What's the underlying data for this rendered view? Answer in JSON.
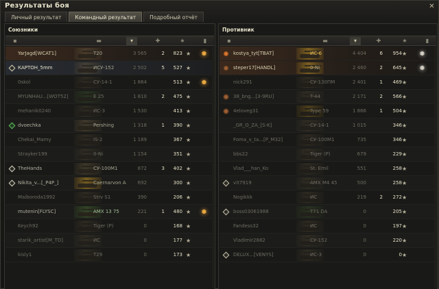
{
  "window": {
    "title": "Результаты боя",
    "close_glyph": "✕"
  },
  "tabs": [
    {
      "label": "Личный результат",
      "active": false
    },
    {
      "label": "Командный результат",
      "active": true
    },
    {
      "label": "Подробный отчёт",
      "active": false
    }
  ],
  "columns": {
    "icons": [
      "rank-icon",
      "vehicle-icon",
      "damage-icon",
      "frags-icon",
      "xp-icon",
      "medal-icon"
    ],
    "sorted_column": "damage-icon"
  },
  "allies": {
    "title": "Союзники",
    "rows": [
      {
        "name": "YarJagd[WCAT1]",
        "vehicle": "T20",
        "damage": "3 565",
        "frags": "2",
        "xp": "823",
        "badge": null,
        "medal": "gold",
        "style": "player",
        "vclass": "",
        "tank": "t-heavy",
        "dead": false
      },
      {
        "name": "КАРТОН_5mm",
        "vehicle": "ИСУ-152",
        "damage": "2 502",
        "frags": "5",
        "xp": "527",
        "badge": "diamond",
        "medal": null,
        "style": "selected",
        "vclass": "",
        "tank": "t-heavy",
        "dead": false
      },
      {
        "name": "0skol",
        "vehicle": "СУ-14-1",
        "damage": "1 864",
        "frags": "",
        "xp": "513",
        "badge": null,
        "medal": "gold",
        "style": "",
        "vclass": "",
        "tank": "t-heavy",
        "dead": true
      },
      {
        "name": "MYUNHAU...[WOT52]",
        "vehicle": "E 25",
        "damage": "1 810",
        "frags": "2",
        "xp": "475",
        "badge": null,
        "medal": null,
        "style": "",
        "vclass": "elite",
        "tank": "t-green",
        "dead": true
      },
      {
        "name": "mehanik0240",
        "vehicle": "ИС-3",
        "damage": "1 530",
        "frags": "",
        "xp": "413",
        "badge": null,
        "medal": null,
        "style": "",
        "vclass": "",
        "tank": "t-heavy",
        "dead": true
      },
      {
        "name": "dvoechka",
        "vehicle": "Pershing",
        "damage": "1 318",
        "frags": "1",
        "xp": "390",
        "badge": "green",
        "medal": null,
        "style": "",
        "vclass": "",
        "tank": "t-heavy",
        "dead": false
      },
      {
        "name": "Chekai_Mamy",
        "vehicle": "IS-2",
        "damage": "1 189",
        "frags": "",
        "xp": "367",
        "badge": null,
        "medal": null,
        "style": "",
        "vclass": "",
        "tank": "t-heavy",
        "dead": true
      },
      {
        "name": "Strayker199",
        "vehicle": "0-Ni",
        "damage": "1 154",
        "frags": "",
        "xp": "351",
        "badge": null,
        "medal": null,
        "style": "",
        "vclass": "",
        "tank": "t-heavy",
        "dead": true
      },
      {
        "name": "TheHands",
        "vehicle": "СУ-100М1",
        "damage": "872",
        "frags": "3",
        "xp": "402",
        "badge": "diamond",
        "medal": null,
        "style": "",
        "vclass": "",
        "tank": "t-heavy",
        "dead": false
      },
      {
        "name": "Nikita_v...[_P4P_]",
        "vehicle": "Caernarvon A",
        "damage": "692",
        "frags": "",
        "xp": "300",
        "badge": "diamond",
        "medal": null,
        "style": "",
        "vclass": "",
        "tank": "t-gold",
        "dead": false
      },
      {
        "name": "Maiboroda1992",
        "vehicle": "Strv S1",
        "damage": "390",
        "frags": "",
        "xp": "206",
        "badge": null,
        "medal": null,
        "style": "",
        "vclass": "",
        "tank": "t-heavy",
        "dead": true
      },
      {
        "name": "mutenin[FLYSC]",
        "vehicle": "AMX 13 75",
        "damage": "221",
        "frags": "1",
        "xp": "480",
        "badge": null,
        "medal": "gold",
        "style": "",
        "vclass": "elite",
        "tank": "t-green",
        "dead": false
      },
      {
        "name": "Keych92",
        "vehicle": "Tiger (P)",
        "damage": "0",
        "frags": "",
        "xp": "168",
        "badge": null,
        "medal": null,
        "style": "",
        "vclass": "",
        "tank": "t-heavy",
        "dead": true
      },
      {
        "name": "starik_artist[M_TD]",
        "vehicle": "ИС",
        "damage": "0",
        "frags": "",
        "xp": "177",
        "badge": null,
        "medal": null,
        "style": "",
        "vclass": "",
        "tank": "t-heavy",
        "dead": true
      },
      {
        "name": "kisly1",
        "vehicle": "T29",
        "damage": "0",
        "frags": "",
        "xp": "173",
        "badge": null,
        "medal": null,
        "style": "",
        "vclass": "",
        "tank": "t-heavy",
        "dead": true
      }
    ]
  },
  "enemies": {
    "title": "Противник",
    "rows": [
      {
        "name": "kostya_tyt[TBAT]",
        "vehicle": "ИС-6",
        "damage": "4 404",
        "frags": "6",
        "xp": "954",
        "badge": "round",
        "medal": "silver",
        "style": "player",
        "vclass": "prem",
        "tank": "t-gold",
        "dead": false
      },
      {
        "name": "steper17[HANDL]",
        "vehicle": "0-Ni",
        "damage": "2 460",
        "frags": "2",
        "xp": "645",
        "badge": "round-dim",
        "medal": "silver",
        "style": "player",
        "vclass": "",
        "tank": "t-gold",
        "dead": false
      },
      {
        "name": "nick291",
        "vehicle": "СУ-130ПМ",
        "damage": "2 401",
        "frags": "1",
        "xp": "469",
        "badge": null,
        "medal": null,
        "style": "",
        "vclass": "",
        "tank": "t-heavy",
        "dead": true
      },
      {
        "name": "38_bng...[3-9RU]",
        "vehicle": "T-44",
        "damage": "2 171",
        "frags": "2",
        "xp": "566",
        "badge": "round-dim",
        "medal": null,
        "style": "",
        "vclass": "",
        "tank": "t-heavy",
        "dead": true
      },
      {
        "name": "4eloveg31",
        "vehicle": "Type 59",
        "damage": "1 866",
        "frags": "1",
        "xp": "504",
        "badge": "round-dim",
        "medal": null,
        "style": "",
        "vclass": "prem",
        "tank": "t-gold",
        "dead": true
      },
      {
        "name": "_GR_O_ZA_[S-K]",
        "vehicle": "СУ-14-1",
        "damage": "1 015",
        "frags": "",
        "xp": "346",
        "badge": null,
        "medal": null,
        "style": "",
        "vclass": "",
        "tank": "t-heavy",
        "dead": true
      },
      {
        "name": "Foma_v_ta...[P_M32]",
        "vehicle": "СУ-100М1",
        "damage": "735",
        "frags": "",
        "xp": "346",
        "badge": null,
        "medal": null,
        "style": "",
        "vclass": "",
        "tank": "t-heavy",
        "dead": true
      },
      {
        "name": "bbs22",
        "vehicle": "Tiger (P)",
        "damage": "679",
        "frags": "",
        "xp": "229",
        "badge": null,
        "medal": null,
        "style": "",
        "vclass": "",
        "tank": "t-heavy",
        "dead": true
      },
      {
        "name": "Vlad___han_Ko",
        "vehicle": "St. Emil",
        "damage": "551",
        "frags": "",
        "xp": "258",
        "badge": null,
        "medal": null,
        "style": "",
        "vclass": "",
        "tank": "t-heavy",
        "dead": true
      },
      {
        "name": "vit7919",
        "vehicle": "AMX M4 45",
        "damage": "500",
        "frags": "",
        "xp": "258",
        "badge": "diamond-dark",
        "medal": null,
        "style": "",
        "vclass": "",
        "tank": "t-heavy",
        "dead": true
      },
      {
        "name": "Nogikkk",
        "vehicle": "ИС",
        "damage": "219",
        "frags": "2",
        "xp": "272",
        "badge": null,
        "medal": null,
        "style": "",
        "vclass": "",
        "tank": "t-heavy",
        "dead": true
      },
      {
        "name": "boss03061988",
        "vehicle": "T71 DA",
        "damage": "0",
        "frags": "",
        "xp": "205",
        "badge": "diamond-dark",
        "medal": null,
        "style": "",
        "vclass": "elite",
        "tank": "t-green",
        "dead": true
      },
      {
        "name": "Fandess32",
        "vehicle": "ИС",
        "damage": "0",
        "frags": "",
        "xp": "197",
        "badge": null,
        "medal": null,
        "style": "",
        "vclass": "",
        "tank": "t-heavy",
        "dead": true
      },
      {
        "name": "Vladimir2882",
        "vehicle": "СУ-152",
        "damage": "0",
        "frags": "",
        "xp": "220",
        "badge": null,
        "medal": null,
        "style": "",
        "vclass": "",
        "tank": "t-heavy",
        "dead": true
      },
      {
        "name": "DELUX...[VENYS]",
        "vehicle": "ИС-3",
        "damage": "0",
        "frags": "",
        "xp": "0",
        "badge": "diamond-dark",
        "medal": null,
        "style": "",
        "vclass": "",
        "tank": "t-heavy",
        "dead": true
      }
    ]
  }
}
